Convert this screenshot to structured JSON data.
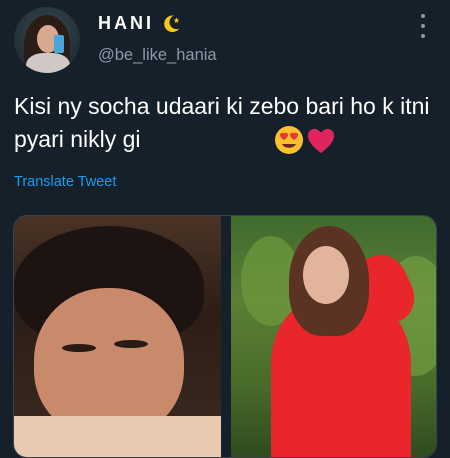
{
  "tweet": {
    "display_name": "HANI",
    "handle": "@be_like_hania",
    "text": "Kisi ny socha udaari ki zebo bari ho k itni pyari nikly gi",
    "emojis": [
      "heart-eyes-emoji",
      "red-heart-emoji"
    ],
    "translate_label": "Translate Tweet"
  },
  "colors": {
    "background": "#15202b",
    "link": "#1d9bf0",
    "secondary_text": "#8b98a5"
  }
}
